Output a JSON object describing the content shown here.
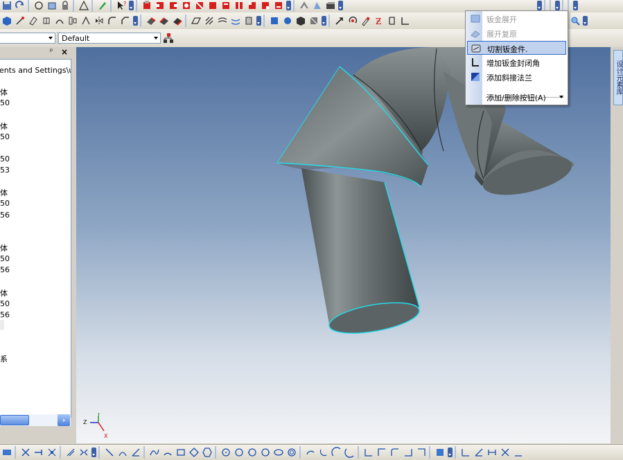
{
  "toolbar": {
    "style_value": "Default"
  },
  "tree_panel": {
    "pin_glyph": "ᵖ",
    "close_glyph": "×",
    "path_text": "Documents and Settings\\user\\桌",
    "rows": [
      {
        "text": "体"
      },
      {
        "text": "50"
      },
      {
        "text": "体"
      },
      {
        "text": "50"
      },
      {
        "text": "50"
      },
      {
        "text": "53"
      },
      {
        "text": "体"
      },
      {
        "text": "50"
      },
      {
        "text": "56"
      },
      {
        "text": "体"
      },
      {
        "text": "50"
      },
      {
        "text": "56"
      },
      {
        "text": "体"
      },
      {
        "text": "50"
      },
      {
        "text": "56"
      },
      {
        "text": "系"
      }
    ]
  },
  "right_tab": {
    "label": "设计元素库"
  },
  "axes": {
    "y": "Y",
    "z": "Z",
    "x": "X"
  },
  "menu": {
    "items": [
      {
        "label": "钣金展开",
        "enabled": false
      },
      {
        "label": "展开复原",
        "enabled": false
      },
      {
        "label": "切割钣金件.",
        "enabled": true,
        "highlighted": true
      },
      {
        "label": "增加钣金封闭角",
        "enabled": true
      },
      {
        "label": "添加斜接法兰",
        "enabled": true
      },
      {
        "label": "添加/删除按钮(A)",
        "enabled": true
      }
    ]
  },
  "colors": {
    "accent": "#316ac5",
    "edge_highlight": "#26d8e8",
    "model_gray": "#7d8586"
  }
}
